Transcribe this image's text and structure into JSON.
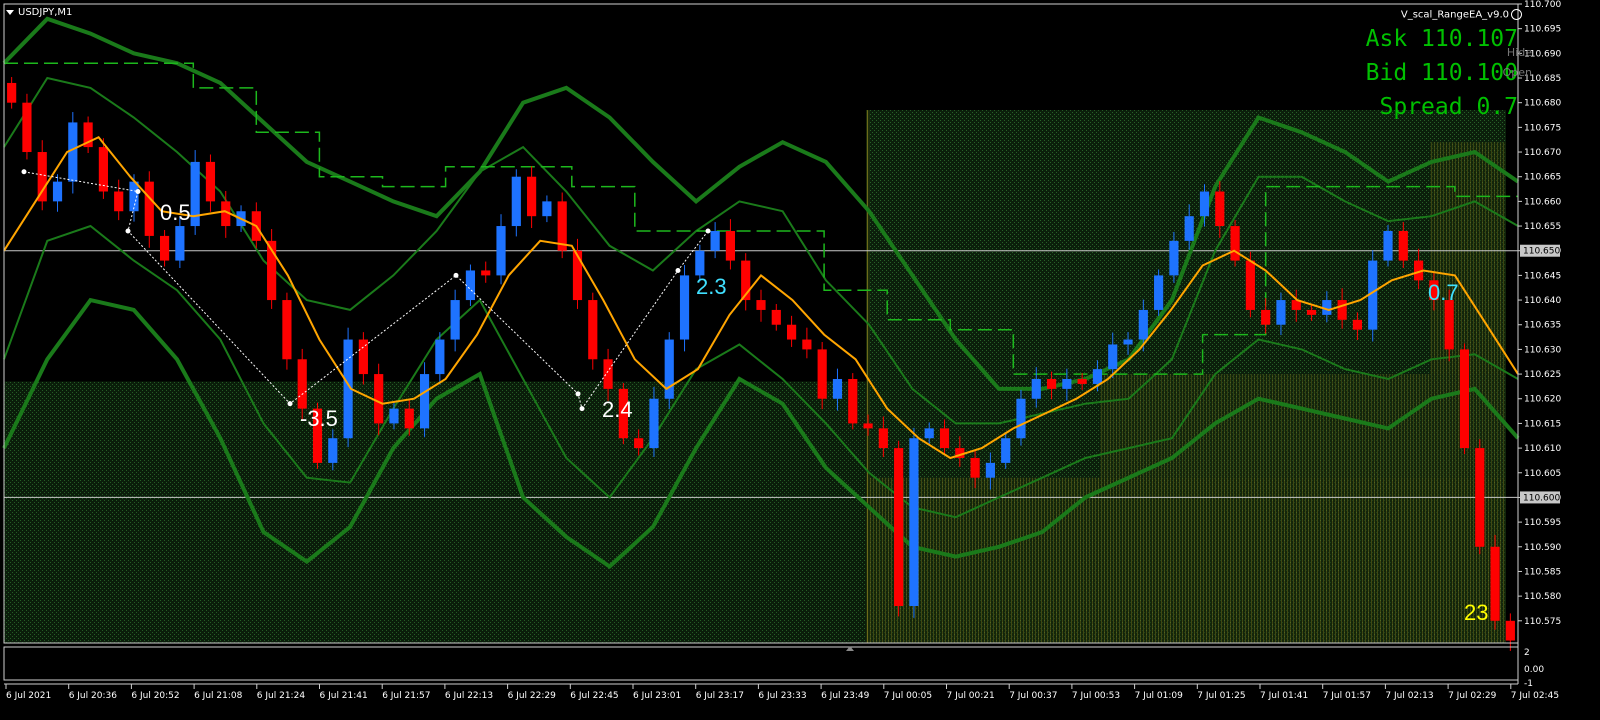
{
  "window": {
    "symbol": "USDJPY,M1",
    "ea_name": "V_scal_RangeEA_v9.0"
  },
  "quote": {
    "ask_label": "Ask 110.107",
    "bid_label": "Bid 110.100",
    "spread_label": "Spread 0.7"
  },
  "buttons": {
    "hide": "Hide",
    "open": "Open"
  },
  "icons": {
    "smile": "smile-icon",
    "menu": "menu-arrow-icon"
  },
  "colors": {
    "bull": "#1e73ff",
    "bear": "#ff0000",
    "ma": "#ffa500",
    "bands": "#1a7a1a",
    "range_dashed": "#1db81d",
    "zone_fill": "#173a17",
    "zone_yellow": "#5a5a1a",
    "level_line": "#c8c8c8",
    "zigzag": "#ffffff",
    "label_white": "#ffffff",
    "label_cyan": "#40e0ff",
    "label_yellow": "#ffff00",
    "quote_green": "#00c000",
    "axis_text": "#ffffff"
  },
  "chart_data": {
    "type": "candlestick",
    "title": "USDJPY,M1",
    "ylim": [
      110.5705,
      110.7
    ],
    "grid": false,
    "y_ticks": [
      "110.700",
      "110.695",
      "110.690",
      "110.685",
      "110.680",
      "110.675",
      "110.670",
      "110.665",
      "110.660",
      "110.655",
      "110.650",
      "110.645",
      "110.640",
      "110.635",
      "110.630",
      "110.625",
      "110.620",
      "110.615",
      "110.610",
      "110.605",
      "110.600",
      "110.595",
      "110.590",
      "110.585",
      "110.580",
      "110.575"
    ],
    "x_ticks": [
      "6 Jul 2021",
      "6 Jul 20:36",
      "6 Jul 20:52",
      "6 Jul 21:08",
      "6 Jul 21:24",
      "6 Jul 21:41",
      "6 Jul 21:57",
      "6 Jul 22:13",
      "6 Jul 22:29",
      "6 Jul 22:45",
      "6 Jul 23:01",
      "6 Jul 23:17",
      "6 Jul 23:33",
      "6 Jul 23:49",
      "7 Jul 00:05",
      "7 Jul 00:21",
      "7 Jul 00:37",
      "7 Jul 00:53",
      "7 Jul 01:09",
      "7 Jul 01:25",
      "7 Jul 01:41",
      "7 Jul 01:57",
      "7 Jul 02:13",
      "7 Jul 02:29",
      "7 Jul 02:45"
    ],
    "highlighted_levels": [
      {
        "value": 110.65,
        "label": "110.650"
      },
      {
        "value": 110.6,
        "label": "110.600"
      }
    ],
    "price_path": [
      110.684,
      110.68,
      110.67,
      110.66,
      110.664,
      110.676,
      110.671,
      110.662,
      110.658,
      110.664,
      110.653,
      110.648,
      110.655,
      110.668,
      110.66,
      110.655,
      110.658,
      110.652,
      110.64,
      110.628,
      110.618,
      110.607,
      110.612,
      110.632,
      110.625,
      110.615,
      110.618,
      110.614,
      110.625,
      110.632,
      110.64,
      110.646,
      110.645,
      110.655,
      110.665,
      110.657,
      110.66,
      110.65,
      110.64,
      110.628,
      110.622,
      110.612,
      110.61,
      110.62,
      110.632,
      110.645,
      110.65,
      110.654,
      110.648,
      110.64,
      110.638,
      110.635,
      110.632,
      110.63,
      110.62,
      110.624,
      110.615,
      110.614,
      110.61,
      110.578,
      110.612,
      110.614,
      110.61,
      110.608,
      110.604,
      110.607,
      110.612,
      110.62,
      110.624,
      110.622,
      110.624,
      110.623,
      110.626,
      110.631,
      110.632,
      110.638,
      110.645,
      110.652,
      110.657,
      110.662,
      110.655,
      110.648,
      110.638,
      110.635,
      110.64,
      110.638,
      110.637,
      110.64,
      110.636,
      110.634,
      110.648,
      110.654,
      110.648,
      110.644,
      110.64,
      110.63,
      110.61,
      110.59,
      110.575,
      110.571
    ],
    "series": [
      {
        "name": "",
        "role": "moving-average",
        "values": [
          110.65,
          110.66,
          110.67,
          110.673,
          110.665,
          110.658,
          110.657,
          110.658,
          110.655,
          110.645,
          110.632,
          110.622,
          110.619,
          110.62,
          110.624,
          110.633,
          110.645,
          110.652,
          110.651,
          110.64,
          110.628,
          110.622,
          110.626,
          110.637,
          110.645,
          110.64,
          110.633,
          110.628,
          110.618,
          110.612,
          110.608,
          110.61,
          110.614,
          110.617,
          110.62,
          110.624,
          110.63,
          110.638,
          110.647,
          110.65,
          110.646,
          110.64,
          110.638,
          110.64,
          110.644,
          110.646,
          110.645,
          110.635,
          110.625
        ]
      },
      {
        "name": "",
        "role": "upper-band-2",
        "values": [
          110.688,
          110.697,
          110.694,
          110.69,
          110.688,
          110.684,
          110.676,
          110.668,
          110.664,
          110.66,
          110.657,
          110.666,
          110.68,
          110.683,
          110.677,
          110.668,
          110.66,
          110.667,
          110.672,
          110.668,
          110.658,
          110.645,
          110.632,
          110.622,
          110.622,
          110.624,
          110.628,
          110.64,
          110.663,
          110.677,
          110.674,
          110.67,
          110.664,
          110.668,
          110.67,
          110.664
        ]
      },
      {
        "name": "",
        "role": "upper-band-1",
        "values": [
          110.671,
          110.685,
          110.683,
          110.677,
          110.67,
          110.662,
          110.648,
          110.64,
          110.638,
          110.645,
          110.654,
          110.666,
          110.671,
          110.662,
          110.651,
          110.646,
          110.654,
          110.66,
          110.658,
          110.644,
          110.635,
          110.622,
          110.615,
          110.615,
          110.617,
          110.619,
          110.62,
          110.628,
          110.65,
          110.665,
          110.665,
          110.66,
          110.656,
          110.657,
          110.66,
          110.655
        ]
      },
      {
        "name": "",
        "role": "lower-band-1",
        "values": [
          110.628,
          110.652,
          110.655,
          110.648,
          110.642,
          110.632,
          110.615,
          110.604,
          110.603,
          110.618,
          110.632,
          110.64,
          110.624,
          110.608,
          110.6,
          110.612,
          110.626,
          110.631,
          110.624,
          110.615,
          110.605,
          110.598,
          110.596,
          110.6,
          110.604,
          110.608,
          110.61,
          110.612,
          110.625,
          110.632,
          110.63,
          110.626,
          110.624,
          110.628,
          110.629,
          110.624
        ]
      },
      {
        "name": "",
        "role": "lower-band-2",
        "values": [
          110.61,
          110.628,
          110.64,
          110.638,
          110.628,
          110.612,
          110.593,
          110.587,
          110.594,
          110.61,
          110.62,
          110.625,
          110.6,
          110.592,
          110.586,
          110.594,
          110.61,
          110.624,
          110.619,
          110.606,
          110.598,
          110.59,
          110.588,
          110.59,
          110.593,
          110.6,
          110.604,
          110.608,
          110.615,
          110.62,
          110.618,
          110.616,
          110.614,
          110.62,
          110.622,
          110.612
        ]
      },
      {
        "name": "",
        "role": "range-high",
        "values": [
          110.688,
          110.688,
          110.688,
          110.683,
          110.674,
          110.665,
          110.663,
          110.667,
          110.667,
          110.663,
          110.654,
          110.654,
          110.654,
          110.642,
          110.636,
          110.634,
          110.625,
          110.625,
          110.625,
          110.633,
          110.663,
          110.663,
          110.663,
          110.661
        ]
      }
    ],
    "zigzag_points": [
      [
        110.666,
        0
      ],
      [
        110.662,
        1
      ],
      [
        110.654,
        2
      ],
      [
        110.619,
        3
      ],
      [
        110.645,
        4
      ],
      [
        110.621,
        5
      ],
      [
        110.618,
        6
      ],
      [
        110.646,
        7
      ],
      [
        110.654,
        8
      ]
    ],
    "annotations": [
      {
        "text": "0.5",
        "color": "white"
      },
      {
        "text": "-3.5",
        "color": "white"
      },
      {
        "text": "2.4",
        "color": "white"
      },
      {
        "text": "2.3",
        "color": "cyan"
      },
      {
        "text": "0.7",
        "color": "cyan"
      },
      {
        "text": "23",
        "color": "yellow"
      }
    ],
    "sub_window": {
      "ticks": [
        "2",
        "0.00",
        "-1"
      ]
    }
  }
}
